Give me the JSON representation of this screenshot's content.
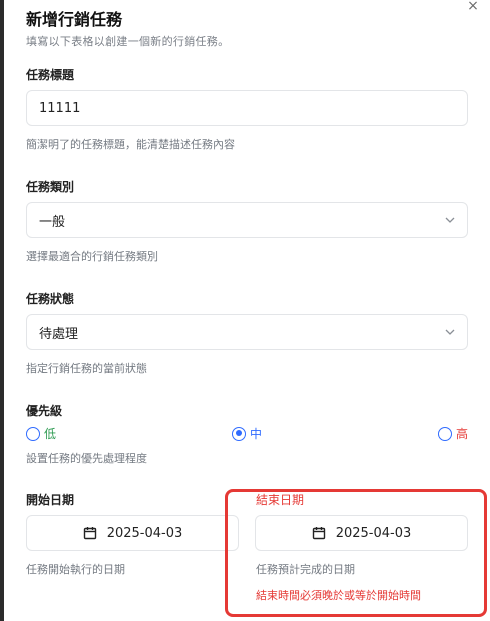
{
  "dialog": {
    "title": "新增行銷任務",
    "subtitle": "填寫以下表格以創建一個新的行銷任務。",
    "close_glyph": "×"
  },
  "task_title": {
    "label": "任務標題",
    "value": "11111",
    "help": "簡潔明了的任務標題，能清楚描述任務內容"
  },
  "task_type": {
    "label": "任務類別",
    "value": "一般",
    "help": "選擇最適合的行銷任務類別"
  },
  "task_status": {
    "label": "任務狀態",
    "value": "待處理",
    "help": "指定行銷任務的當前狀態"
  },
  "priority": {
    "label": "優先級",
    "options": [
      "低",
      "中",
      "高"
    ],
    "selected": "中",
    "help": "設置任務的優先處理程度",
    "colors": {
      "低": "#2e9b52",
      "中": "#2f6bff",
      "高": "#e53935"
    }
  },
  "start_date": {
    "label": "開始日期",
    "value": "2025-04-03",
    "help": "任務開始執行的日期"
  },
  "end_date": {
    "label": "結束日期",
    "value": "2025-04-03",
    "help": "任務預計完成的日期",
    "error": "結束時間必須晚於或等於開始時間"
  },
  "colors": {
    "error": "#e53935",
    "accent": "#2f6bff"
  }
}
